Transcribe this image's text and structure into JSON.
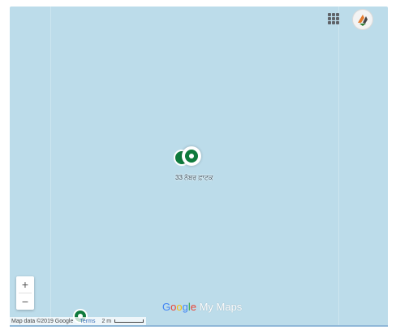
{
  "map": {
    "background_color": "#bcdcea",
    "marker_color": "#0f7a3c"
  },
  "header": {
    "apps_icon": "apps-grid-icon",
    "avatar_icon": "account-avatar-icon"
  },
  "marker": {
    "label": "33 ਨੰਬਰ ਫ਼ਾਟਕ"
  },
  "zoom": {
    "in_label": "+",
    "out_label": "−"
  },
  "branding": {
    "google_letters": [
      "G",
      "o",
      "o",
      "g",
      "l",
      "e"
    ],
    "google_colors": [
      "#4285f4",
      "#ea4335",
      "#fbbc05",
      "#4285f4",
      "#34a853",
      "#ea4335"
    ],
    "product": " My Maps"
  },
  "attribution": {
    "map_data": "Map data ©2019 Google",
    "terms": "Terms",
    "scale": "2 m"
  }
}
